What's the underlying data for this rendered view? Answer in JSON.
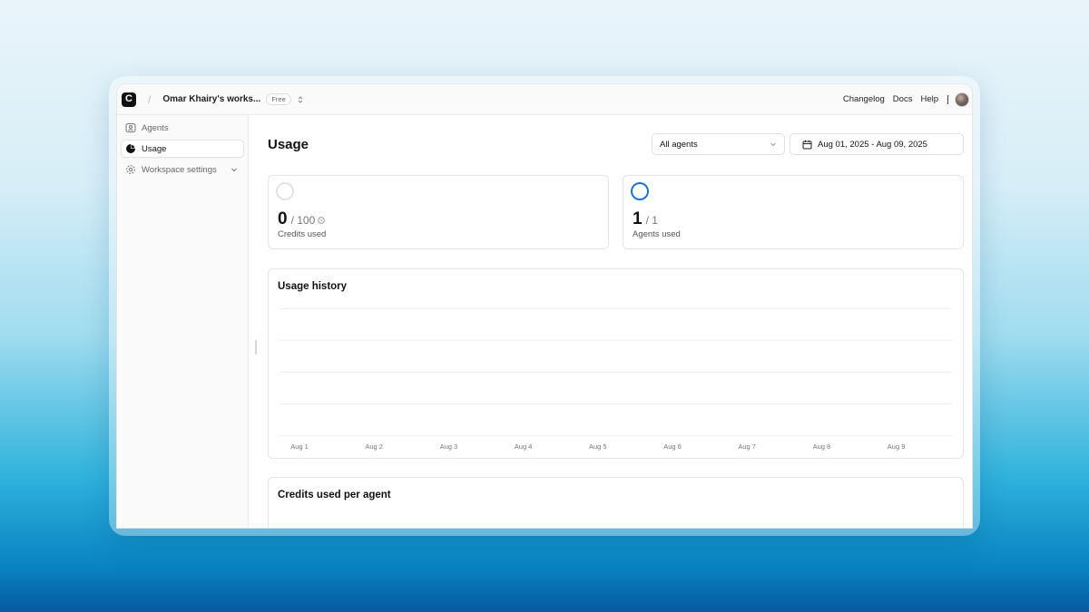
{
  "topbar": {
    "logo_letter": "C",
    "separator": "/",
    "workspace_name": "Omar Khairy's works...",
    "plan_badge": "Free",
    "links": [
      "Changelog",
      "Docs",
      "Help"
    ]
  },
  "sidebar": {
    "items": [
      {
        "label": "Agents",
        "icon": "agent-icon",
        "active": false
      },
      {
        "label": "Usage",
        "icon": "pie-chart-icon",
        "active": true
      },
      {
        "label": "Workspace settings",
        "icon": "gear-icon",
        "active": false
      }
    ]
  },
  "main": {
    "title": "Usage",
    "agent_filter": {
      "value": "All agents"
    },
    "date_range": {
      "value": "Aug 01, 2025 - Aug 09, 2025"
    },
    "stats": [
      {
        "value": "0",
        "of": "/ 100",
        "label": "Credits used",
        "ring_color": "#e3e3e3"
      },
      {
        "value": "1",
        "of": "/ 1",
        "label": "Agents used",
        "ring_color": "#1c73d6"
      }
    ],
    "usage_history": {
      "title": "Usage history"
    },
    "credits_per_agent": {
      "title": "Credits used per agent"
    }
  },
  "chart_data": {
    "type": "bar",
    "title": "Usage history",
    "categories": [
      "Aug 1",
      "Aug 2",
      "Aug 3",
      "Aug 4",
      "Aug 5",
      "Aug 6",
      "Aug 7",
      "Aug 8",
      "Aug 9"
    ],
    "values": [
      0,
      0,
      0,
      0,
      0,
      0,
      0,
      0,
      0
    ],
    "grid": true
  },
  "colors": {
    "accent": "#1c73d6"
  }
}
